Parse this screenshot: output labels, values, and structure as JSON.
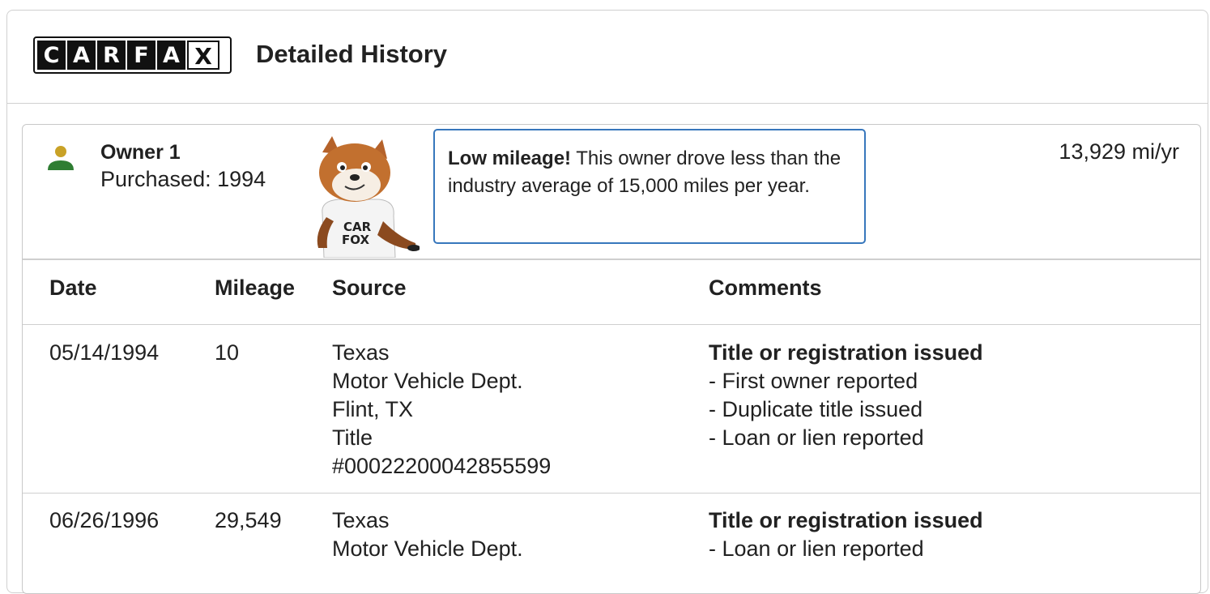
{
  "header": {
    "logo_letters": [
      "C",
      "A",
      "R",
      "F",
      "A",
      "X"
    ],
    "title": "Detailed History"
  },
  "owner": {
    "name": "Owner 1",
    "purchased": "Purchased: 1994",
    "mileage_rate": "13,929 mi/yr",
    "icon_colors": {
      "head": "#c9a227",
      "body": "#2e7d32"
    },
    "mascot_shirt": [
      "CAR",
      "FOX"
    ],
    "callout": {
      "bold": "Low mileage!",
      "text": " This owner drove less than the industry average of 15,000 miles per year."
    }
  },
  "table": {
    "columns": [
      "Date",
      "Mileage",
      "Source",
      "Comments"
    ],
    "rows": [
      {
        "date": "05/14/1994",
        "mileage": "10",
        "source": [
          "Texas",
          "Motor Vehicle Dept.",
          "Flint, TX",
          "Title",
          "#00022200042855599"
        ],
        "comment_title": "Title or registration issued",
        "comments": [
          "First owner reported",
          "Duplicate title issued",
          "Loan or lien reported"
        ]
      },
      {
        "date": "06/26/1996",
        "mileage": "29,549",
        "source": [
          "Texas",
          "Motor Vehicle Dept."
        ],
        "comment_title": "Title or registration issued",
        "comments": [
          "Loan or lien reported"
        ]
      }
    ]
  }
}
